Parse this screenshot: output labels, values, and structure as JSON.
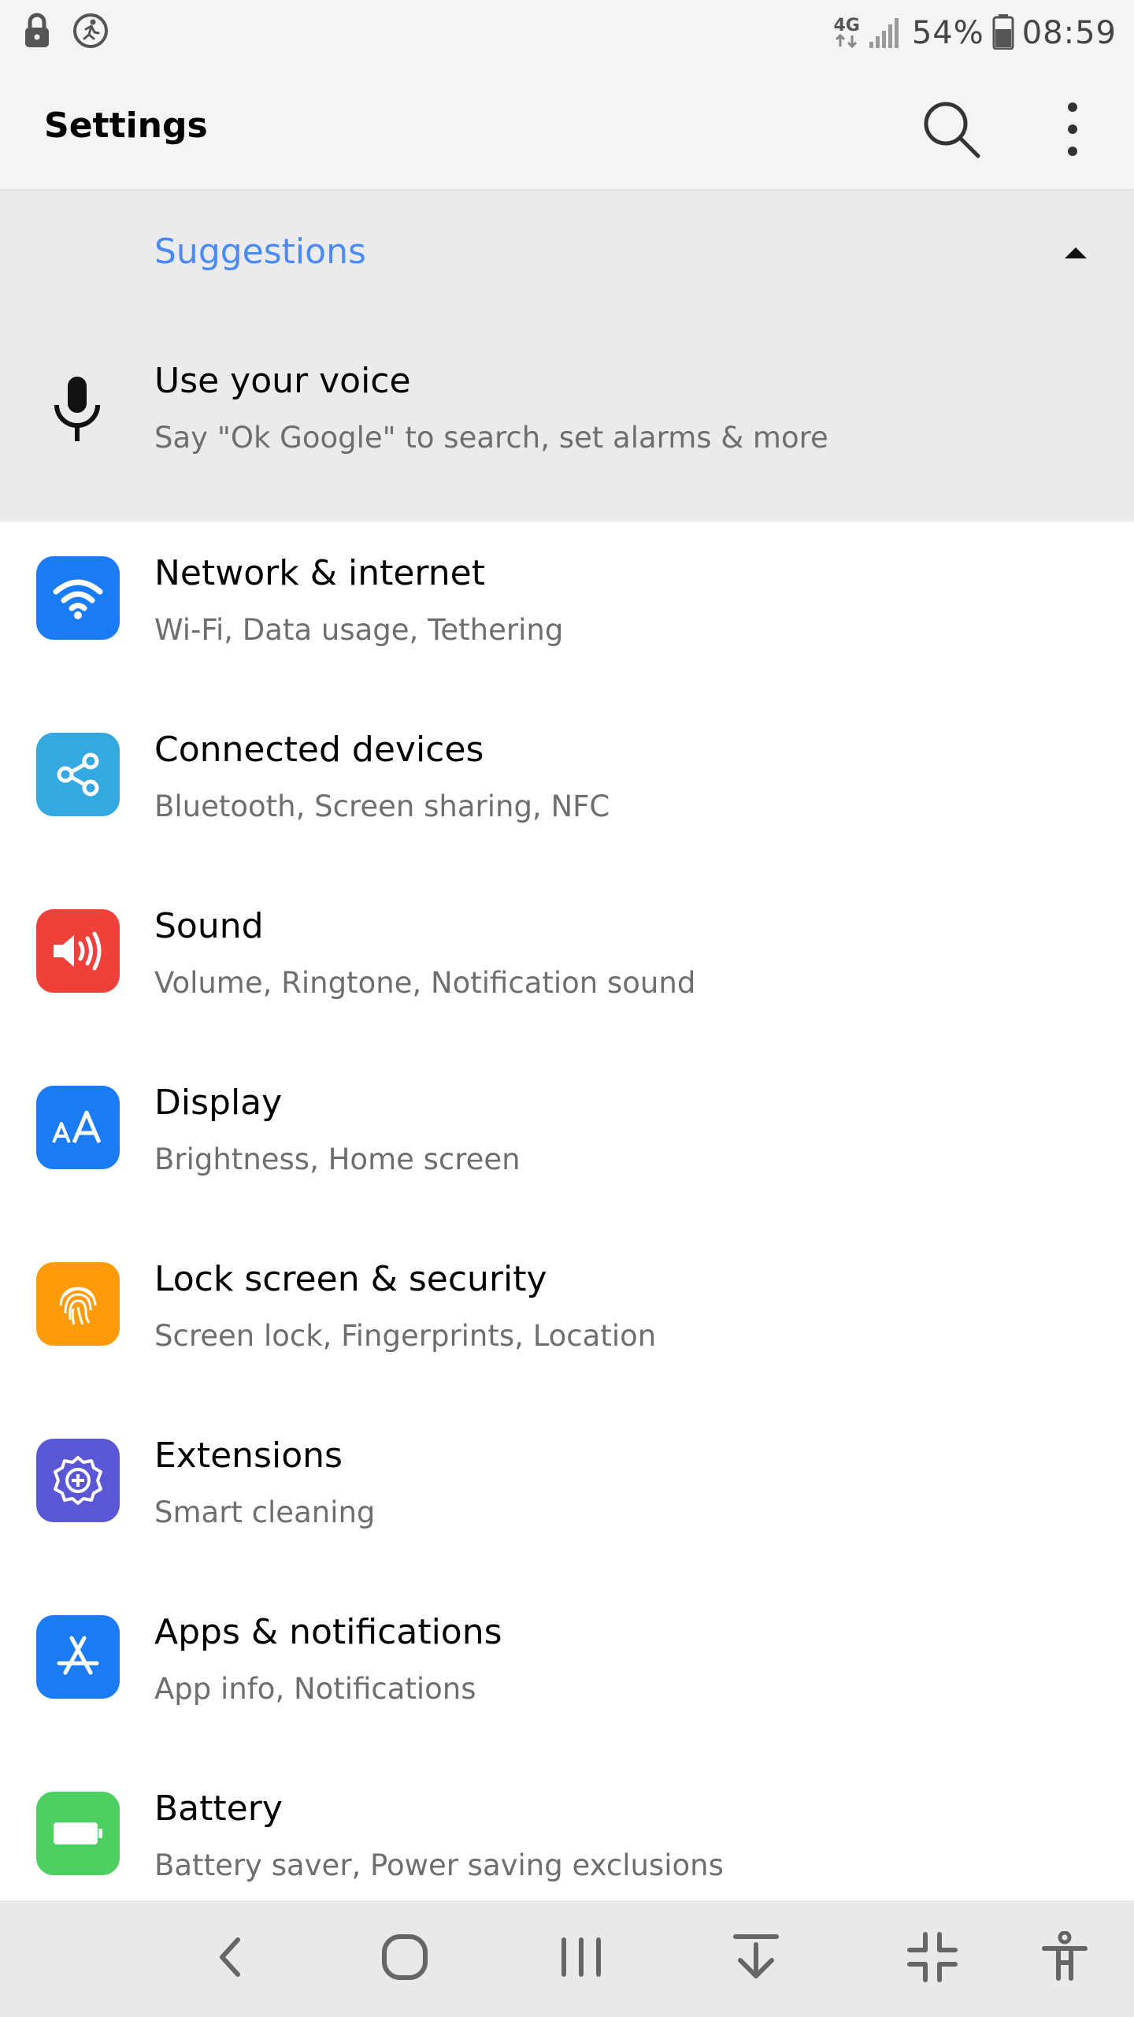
{
  "status_bar": {
    "network": "4G",
    "battery": "54%",
    "time": "08:59",
    "icons": [
      "lock-icon",
      "running-person-icon",
      "network-4g-icon",
      "signal-icon",
      "battery-icon"
    ]
  },
  "app_bar": {
    "title": "Settings",
    "icons": [
      "search-icon",
      "more-vert-icon"
    ]
  },
  "suggestions": {
    "title": "Suggestions",
    "collapse_icon": "arrow-up-icon",
    "item": {
      "icon": "mic-icon",
      "title": "Use your voice",
      "subtitle": "Say \"Ok Google\" to search, set alarms & more"
    }
  },
  "settings": {
    "items": [
      {
        "title": "Network & internet",
        "subtitle": "Wi-Fi, Data usage, Tethering",
        "icon": "wifi-icon",
        "color": "#1a7cf5"
      },
      {
        "title": "Connected devices",
        "subtitle": "Bluetooth, Screen sharing, NFC",
        "icon": "share-icon",
        "color": "#34a8e0"
      },
      {
        "title": "Sound",
        "subtitle": "Volume, Ringtone, Notification sound",
        "icon": "speaker-icon",
        "color": "#f0403a"
      },
      {
        "title": "Display",
        "subtitle": "Brightness, Home screen",
        "icon": "text-size-icon",
        "color": "#1a7cf5"
      },
      {
        "title": "Lock screen & security",
        "subtitle": "Screen lock, Fingerprints, Location",
        "icon": "fingerprint-icon",
        "color": "#ff9a0a"
      },
      {
        "title": "Extensions",
        "subtitle": "Smart cleaning",
        "icon": "gear-plus-icon",
        "color": "#5a56d6"
      },
      {
        "title": "Apps & notifications",
        "subtitle": "App info, Notifications",
        "icon": "app-store-icon",
        "color": "#1a7cf5"
      },
      {
        "title": "Battery",
        "subtitle": "Battery saver, Power saving exclusions",
        "icon": "battery-icon",
        "color": "#4cd060"
      }
    ]
  },
  "nav_bar": {
    "buttons": [
      "back-icon",
      "home-icon",
      "recents-icon",
      "download-icon",
      "collapse-icon",
      "accessibility-icon"
    ]
  },
  "colors": {
    "accent": "#4a8af4",
    "header_bg": "#f4f4f6",
    "suggestions_bg": "#ebebed",
    "navbar_bg": "#e9e9ec"
  }
}
